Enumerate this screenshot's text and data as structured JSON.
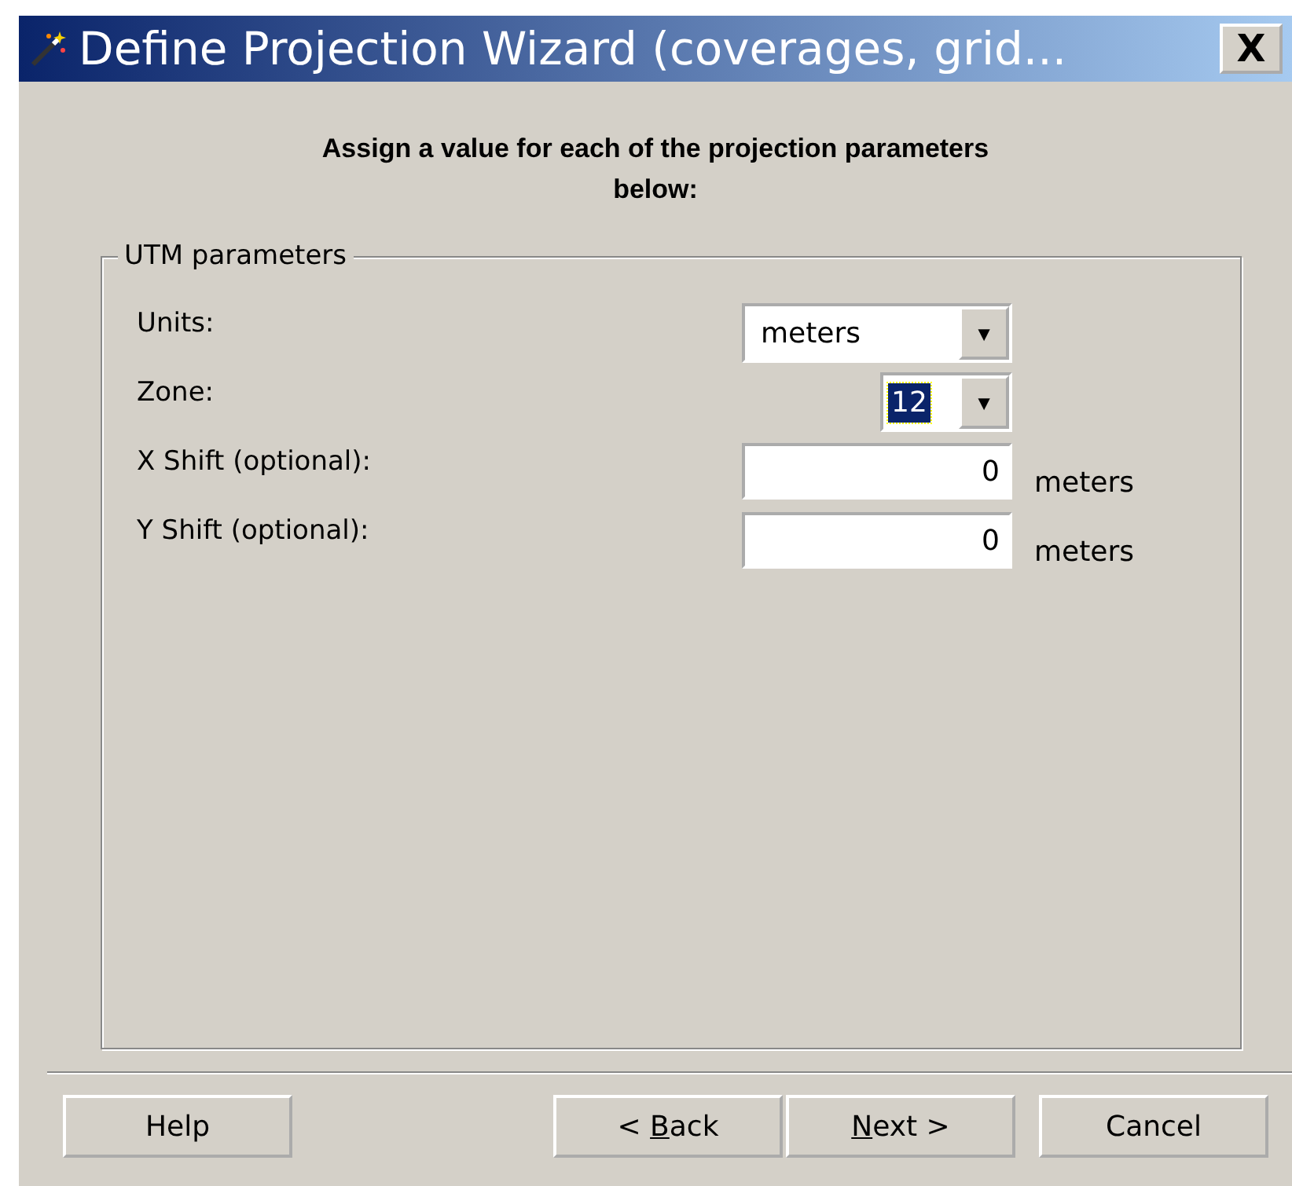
{
  "window": {
    "title": "Define Projection Wizard (coverages, grid..."
  },
  "close_button": {
    "label": "X"
  },
  "heading": "Assign a value for each of the projection parameters below:",
  "group": {
    "title": "UTM parameters",
    "rows": [
      {
        "kind": "combo",
        "label": "Units:",
        "value": "meters",
        "focused": false,
        "arrow": "▼"
      },
      {
        "kind": "combo",
        "label": "Zone:",
        "value": "12",
        "focused": true,
        "arrow": "▼"
      },
      {
        "kind": "text",
        "label": "X Shift (optional):",
        "value": "0",
        "unit": "meters"
      },
      {
        "kind": "text",
        "label": "Y Shift (optional):",
        "value": "0",
        "unit": "meters"
      }
    ]
  },
  "buttons": [
    {
      "before": "Help"
    },
    {
      "before": "< ",
      "key": "B",
      "after": "ack"
    },
    {
      "key": "N",
      "after": "ext >"
    },
    {
      "before": "Cancel"
    }
  ]
}
